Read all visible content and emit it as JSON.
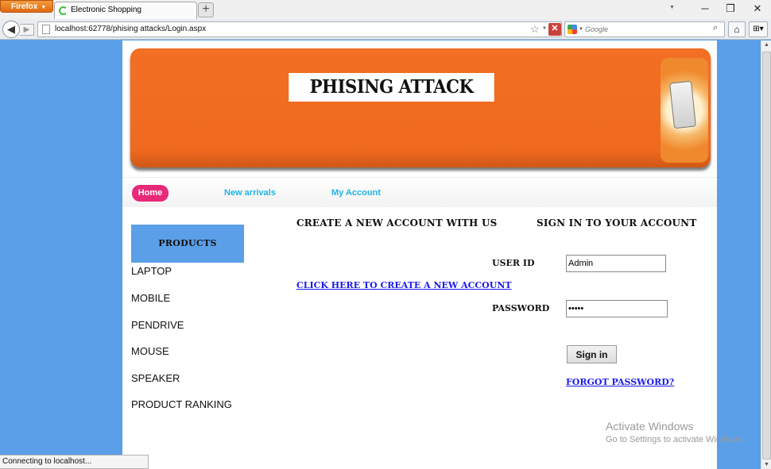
{
  "browser": {
    "app_menu_label": "Firefox",
    "tab_title": "Electronic Shopping",
    "new_tab_label": "+",
    "url": "localhost:62778/phising attacks/Login.aspx",
    "search_placeholder": "Google",
    "status_text": "Connecting to localhost..."
  },
  "banner": {
    "title": "PHISING ATTACK"
  },
  "nav": {
    "home": "Home",
    "new_arrivals": "New arrivals",
    "my_account": "My Account"
  },
  "sidebar": {
    "heading": "PRODUCTS",
    "items": [
      "LAPTOP",
      "MOBILE",
      "PENDRIVE",
      "MOUSE",
      "SPEAKER",
      "PRODUCT RANKING"
    ]
  },
  "create_account": {
    "title": "CREATE A NEW ACCOUNT WITH US",
    "link": "CLICK HERE TO CREATE A NEW ACCOUNT"
  },
  "signin": {
    "title": "SIGN IN TO YOUR ACCOUNT",
    "user_label": "USER ID",
    "user_value": "Admin",
    "password_label": "PASSWORD",
    "password_value": "•••••",
    "button": "Sign in",
    "forgot": "FORGOT PASSWORD?"
  },
  "watermark": {
    "line1": "Activate Windows",
    "line2": "Go to Settings to activate Windows."
  },
  "colors": {
    "background": "#5b9fe8",
    "banner": "#f26f24",
    "home_pill": "#e8297a",
    "nav_link": "#20b3e3",
    "link": "#1a1aee"
  }
}
